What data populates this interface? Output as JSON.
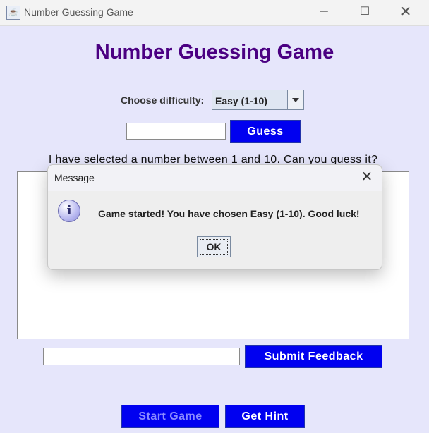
{
  "window": {
    "title": "Number Guessing Game",
    "app_icon": "java-icon",
    "controls": {
      "minimize": "─",
      "maximize": "☐",
      "close": "✕"
    }
  },
  "main": {
    "title": "Number Guessing Game",
    "difficulty_label": "Choose difficulty:",
    "difficulty_selected": "Easy (1-10)",
    "guess_input_value": "",
    "guess_button": "Guess",
    "prompt": "I have selected a number between 1 and 10. Can you guess it?",
    "feedback_input_value": "",
    "submit_feedback_button": "Submit Feedback",
    "start_game_button": "Start Game",
    "get_hint_button": "Get Hint"
  },
  "dialog": {
    "title": "Message",
    "icon": "info-icon",
    "icon_glyph": "i",
    "message": "Game started! You have chosen Easy (1-10). Good luck!",
    "ok_button": "OK",
    "close_glyph": "✕"
  },
  "colors": {
    "background": "#e6e6fb",
    "title": "#4b0082",
    "button": "#0000f0",
    "button_disabled_text": "#8a8aff"
  }
}
